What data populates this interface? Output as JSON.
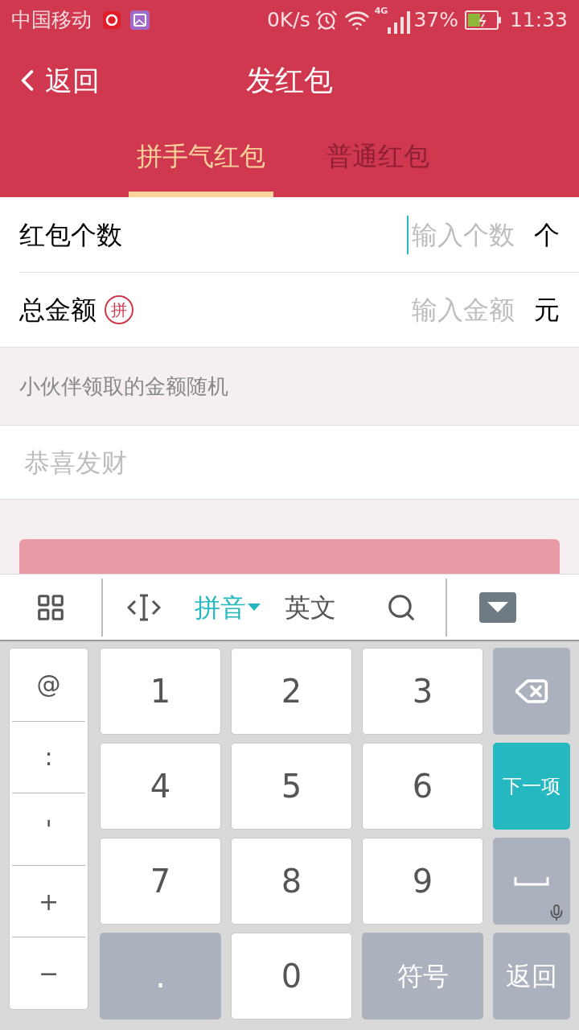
{
  "status_bar": {
    "carrier": "中国移动",
    "speed": "0K/s",
    "network": "4G",
    "battery": "37%",
    "time": "11:33"
  },
  "header": {
    "back": "返回",
    "title": "发红包"
  },
  "tabs": [
    {
      "label": "拼手气红包",
      "selected": true
    },
    {
      "label": "普通红包",
      "selected": false
    }
  ],
  "form_rows": [
    {
      "label": "红包个数",
      "placeholder": "输入个数",
      "unit": "个",
      "focused": true
    },
    {
      "label": "总金额",
      "badge": "拼",
      "placeholder": "输入金额",
      "unit": "元",
      "focused": false
    }
  ],
  "hint": "小伙伴领取的金额随机",
  "greeting": {
    "placeholder": "恭喜发财"
  },
  "keyboard": {
    "modes": [
      {
        "label": "拼音",
        "selected": true
      },
      {
        "label": "英文",
        "selected": false
      }
    ],
    "side_keys": [
      "@",
      ":",
      "'",
      "+",
      "−"
    ],
    "keys": [
      {
        "kind": "light",
        "label": "1"
      },
      {
        "kind": "light",
        "label": "2"
      },
      {
        "kind": "light",
        "label": "3"
      },
      {
        "kind": "backspace"
      },
      {
        "kind": "light",
        "label": "4"
      },
      {
        "kind": "light",
        "label": "5"
      },
      {
        "kind": "light",
        "label": "6"
      },
      {
        "kind": "accent",
        "label": "下一项"
      },
      {
        "kind": "light",
        "label": "7"
      },
      {
        "kind": "light",
        "label": "8"
      },
      {
        "kind": "light",
        "label": "9"
      },
      {
        "kind": "space"
      },
      {
        "kind": "dark",
        "label": "."
      },
      {
        "kind": "light",
        "label": "0"
      },
      {
        "kind": "dark",
        "label": "符号"
      },
      {
        "kind": "dark",
        "label": "返回"
      }
    ]
  }
}
